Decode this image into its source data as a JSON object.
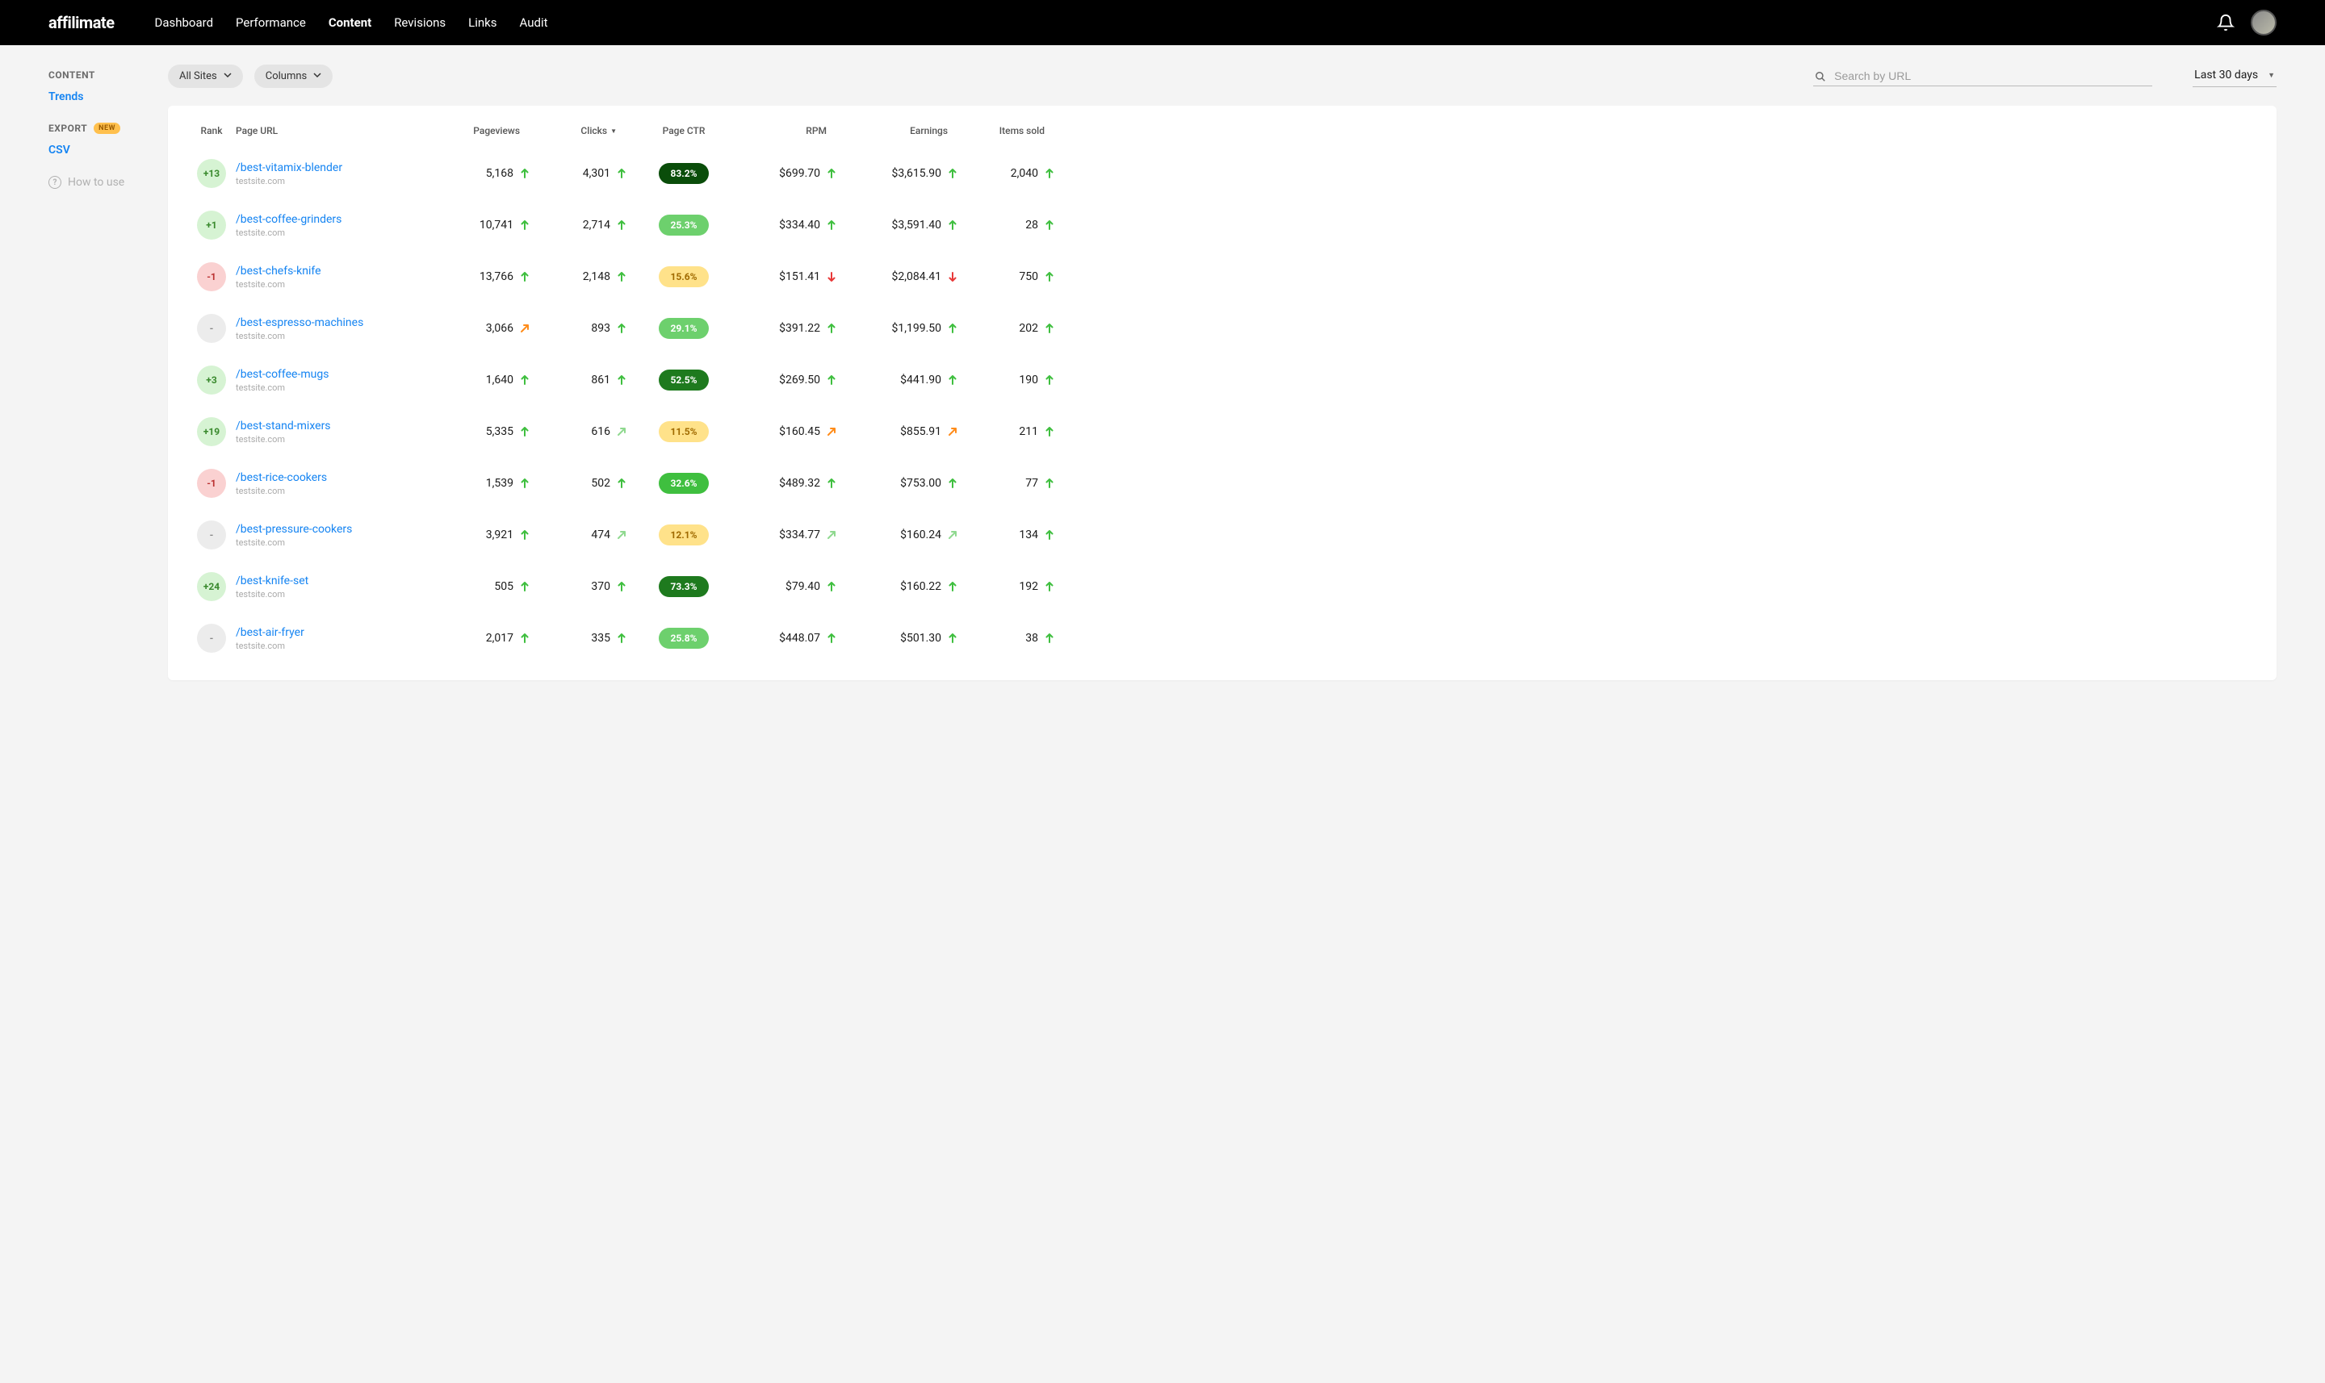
{
  "header": {
    "logo": "affilimate",
    "nav": [
      "Dashboard",
      "Performance",
      "Content",
      "Revisions",
      "Links",
      "Audit"
    ],
    "active_nav": "Content"
  },
  "sidebar": {
    "content_heading": "CONTENT",
    "trends_link": "Trends",
    "export_heading": "EXPORT",
    "new_badge": "NEW",
    "csv_link": "CSV",
    "how_to": "How to use"
  },
  "toolbar": {
    "sites_label": "All Sites",
    "columns_label": "Columns",
    "search_placeholder": "Search by URL",
    "daterange": "Last 30 days"
  },
  "table": {
    "headers": {
      "rank": "Rank",
      "page": "Page URL",
      "pageviews": "Pageviews",
      "clicks": "Clicks",
      "ctr": "Page CTR",
      "rpm": "RPM",
      "earnings": "Earnings",
      "items": "Items sold"
    },
    "rows": [
      {
        "rank": "+13",
        "rank_class": "rank-up",
        "url": "/best-vitamix-blender",
        "domain": "testsite.com",
        "pageviews": "5,168",
        "pv_arrow": "up",
        "clicks": "4,301",
        "clicks_arrow": "up",
        "ctr": "83.2%",
        "ctr_class": "ctr-darkest",
        "rpm": "$699.70",
        "rpm_arrow": "up",
        "earnings": "$3,615.90",
        "earn_arrow": "up",
        "items": "2,040",
        "items_arrow": "up"
      },
      {
        "rank": "+1",
        "rank_class": "rank-up",
        "url": "/best-coffee-grinders",
        "domain": "testsite.com",
        "pageviews": "10,741",
        "pv_arrow": "up",
        "clicks": "2,714",
        "clicks_arrow": "up",
        "ctr": "25.3%",
        "ctr_class": "ctr-light",
        "rpm": "$334.40",
        "rpm_arrow": "up",
        "earnings": "$3,591.40",
        "earn_arrow": "up",
        "items": "28",
        "items_arrow": "up"
      },
      {
        "rank": "-1",
        "rank_class": "rank-down",
        "url": "/best-chefs-knife",
        "domain": "testsite.com",
        "pageviews": "13,766",
        "pv_arrow": "up",
        "clicks": "2,148",
        "clicks_arrow": "up",
        "ctr": "15.6%",
        "ctr_class": "ctr-yellow",
        "rpm": "$151.41",
        "rpm_arrow": "down",
        "earnings": "$2,084.41",
        "earn_arrow": "down",
        "items": "750",
        "items_arrow": "up"
      },
      {
        "rank": "-",
        "rank_class": "rank-neutral",
        "url": "/best-espresso-machines",
        "domain": "testsite.com",
        "pageviews": "3,066",
        "pv_arrow": "diag-orange",
        "clicks": "893",
        "clicks_arrow": "up",
        "ctr": "29.1%",
        "ctr_class": "ctr-light",
        "rpm": "$391.22",
        "rpm_arrow": "up",
        "earnings": "$1,199.50",
        "earn_arrow": "up",
        "items": "202",
        "items_arrow": "up"
      },
      {
        "rank": "+3",
        "rank_class": "rank-up",
        "url": "/best-coffee-mugs",
        "domain": "testsite.com",
        "pageviews": "1,640",
        "pv_arrow": "up",
        "clicks": "861",
        "clicks_arrow": "up",
        "ctr": "52.5%",
        "ctr_class": "ctr-dark",
        "rpm": "$269.50",
        "rpm_arrow": "up",
        "earnings": "$441.90",
        "earn_arrow": "up",
        "items": "190",
        "items_arrow": "up"
      },
      {
        "rank": "+19",
        "rank_class": "rank-up",
        "url": "/best-stand-mixers",
        "domain": "testsite.com",
        "pageviews": "5,335",
        "pv_arrow": "up",
        "clicks": "616",
        "clicks_arrow": "diag-green",
        "ctr": "11.5%",
        "ctr_class": "ctr-yellow",
        "rpm": "$160.45",
        "rpm_arrow": "diag-orange",
        "earnings": "$855.91",
        "earn_arrow": "diag-orange",
        "items": "211",
        "items_arrow": "up"
      },
      {
        "rank": "-1",
        "rank_class": "rank-down",
        "url": "/best-rice-cookers",
        "domain": "testsite.com",
        "pageviews": "1,539",
        "pv_arrow": "up",
        "clicks": "502",
        "clicks_arrow": "up",
        "ctr": "32.6%",
        "ctr_class": "ctr-mid",
        "rpm": "$489.32",
        "rpm_arrow": "up",
        "earnings": "$753.00",
        "earn_arrow": "up",
        "items": "77",
        "items_arrow": "up"
      },
      {
        "rank": "-",
        "rank_class": "rank-neutral",
        "url": "/best-pressure-cookers",
        "domain": "testsite.com",
        "pageviews": "3,921",
        "pv_arrow": "up",
        "clicks": "474",
        "clicks_arrow": "diag-green",
        "ctr": "12.1%",
        "ctr_class": "ctr-yellow",
        "rpm": "$334.77",
        "rpm_arrow": "diag-green",
        "earnings": "$160.24",
        "earn_arrow": "diag-green",
        "items": "134",
        "items_arrow": "up"
      },
      {
        "rank": "+24",
        "rank_class": "rank-up",
        "url": "/best-knife-set",
        "domain": "testsite.com",
        "pageviews": "505",
        "pv_arrow": "up",
        "clicks": "370",
        "clicks_arrow": "up",
        "ctr": "73.3%",
        "ctr_class": "ctr-dark",
        "rpm": "$79.40",
        "rpm_arrow": "up",
        "earnings": "$160.22",
        "earn_arrow": "up",
        "items": "192",
        "items_arrow": "up"
      },
      {
        "rank": "-",
        "rank_class": "rank-neutral",
        "url": "/best-air-fryer",
        "domain": "testsite.com",
        "pageviews": "2,017",
        "pv_arrow": "up",
        "clicks": "335",
        "clicks_arrow": "up",
        "ctr": "25.8%",
        "ctr_class": "ctr-light",
        "rpm": "$448.07",
        "rpm_arrow": "up",
        "earnings": "$501.30",
        "earn_arrow": "up",
        "items": "38",
        "items_arrow": "up"
      }
    ]
  }
}
